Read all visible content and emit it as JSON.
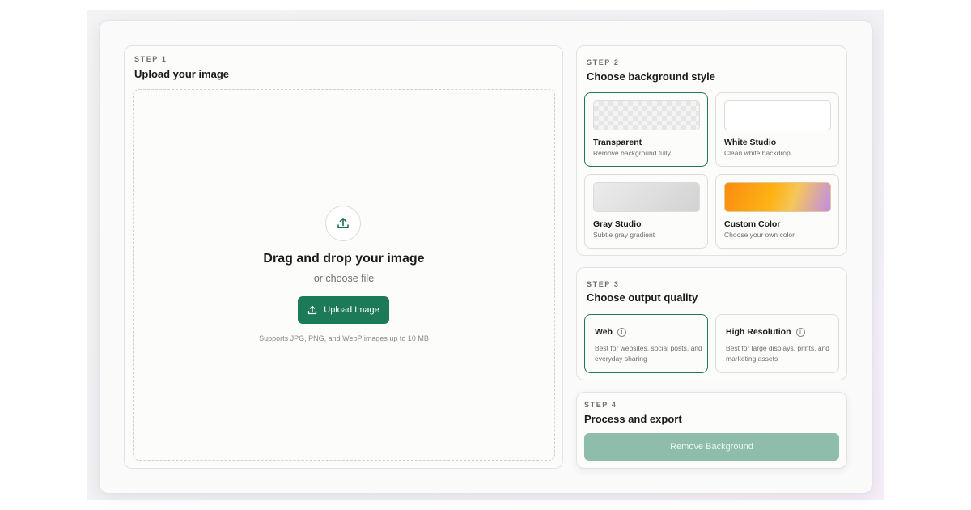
{
  "colors": {
    "accent": "#1d7a58",
    "accent_disabled": "#8ebdab",
    "selected_border": "#1d7a58"
  },
  "step1": {
    "label": "STEP 1",
    "title": "Upload your image",
    "dropzone": {
      "icon": "upload-icon",
      "title": "Drag and drop your image",
      "subtitle": "or choose file",
      "button_label": "Upload Image",
      "note": "Supports JPG, PNG, and WebP images up to 10 MB"
    }
  },
  "step2": {
    "label": "STEP 2",
    "title": "Choose background style",
    "options": [
      {
        "name": "Transparent",
        "desc": "Remove background fully",
        "selected": true
      },
      {
        "name": "White Studio",
        "desc": "Clean white backdrop",
        "selected": false
      },
      {
        "name": "Gray Studio",
        "desc": "Subtle gray gradient",
        "selected": false
      },
      {
        "name": "Custom Color",
        "desc": "Choose your own color",
        "selected": false
      }
    ]
  },
  "step3": {
    "label": "STEP 3",
    "title": "Choose output quality",
    "options": [
      {
        "name": "Web",
        "desc": "Best for websites, social posts, and everyday sharing",
        "selected": true,
        "icon": "info-icon"
      },
      {
        "name": "High Resolution",
        "desc": "Best for large displays, prints, and marketing assets",
        "selected": false,
        "icon": "info-icon"
      }
    ]
  },
  "step4": {
    "label": "STEP 4",
    "title": "Process and export",
    "button_label": "Remove Background",
    "button_enabled": false
  }
}
